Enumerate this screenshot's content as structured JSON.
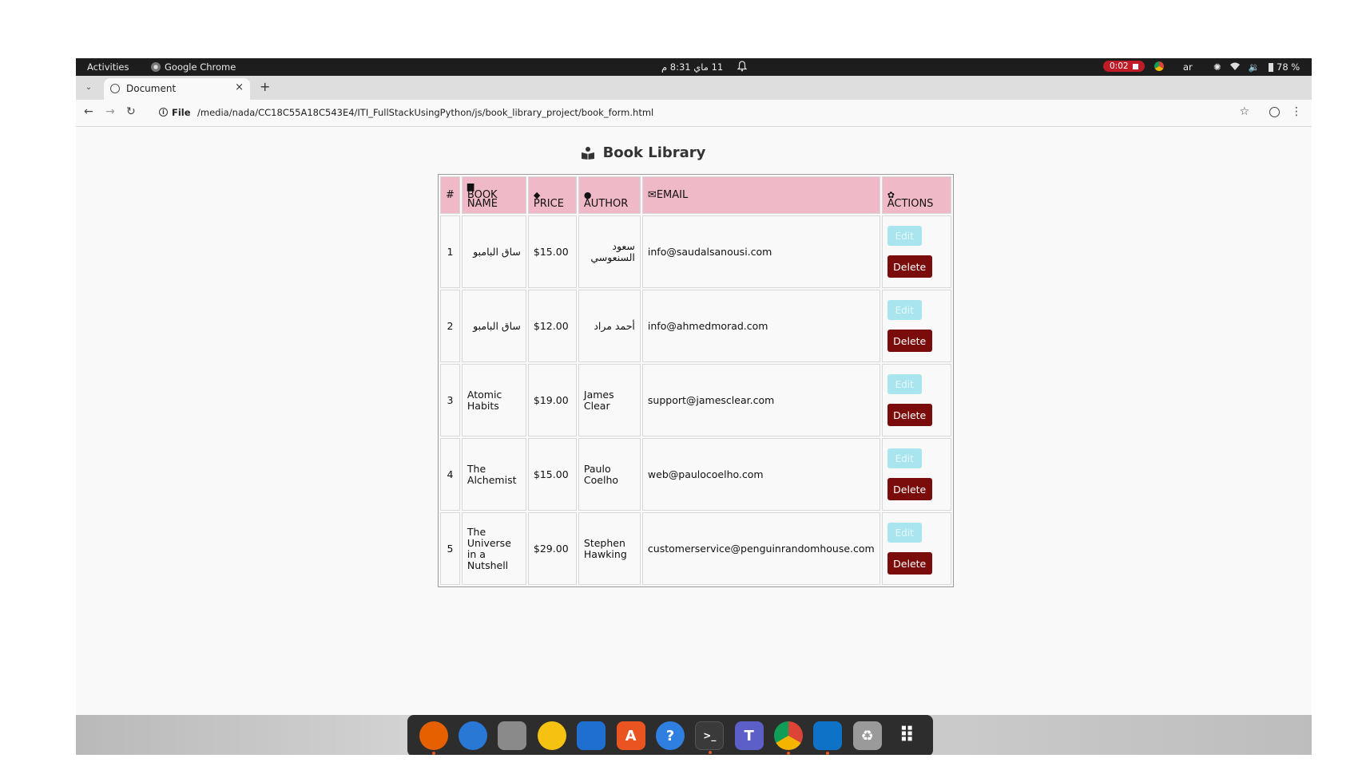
{
  "system_bar": {
    "activities": "Activities",
    "app_name": "Google Chrome",
    "clock": "11 ماي  8:31 م",
    "recording": "0:02",
    "language": "ar",
    "battery": "78 %"
  },
  "browser": {
    "tab_title": "Document",
    "new_tab": "+",
    "close": "×",
    "file_label": "File",
    "url": "/media/nada/CC18C55A18C543E4/ITI_FullStackUsingPython/js/book_library_project/book_form.html"
  },
  "page": {
    "title": "Book Library",
    "columns": {
      "num": "#",
      "book": "BOOK NAME",
      "price": "PRICE",
      "author": "AUTHOR",
      "email": "EMAIL",
      "actions": "ACTIONS"
    },
    "edit_label": "Edit",
    "delete_label": "Delete",
    "rows": [
      {
        "num": "1",
        "book": "ساق البامبو",
        "price": "$15.00",
        "author": "سعود السنعوسي",
        "email": "info@saudalsanousi.com"
      },
      {
        "num": "2",
        "book": "ساق البامبو",
        "price": "$12.00",
        "author": "أحمد مراد",
        "email": "info@ahmedmorad.com"
      },
      {
        "num": "3",
        "book": "Atomic Habits",
        "price": "$19.00",
        "author": "James Clear",
        "email": "support@jamesclear.com"
      },
      {
        "num": "4",
        "book": "The Alchemist",
        "price": "$15.00",
        "author": "Paulo Coelho",
        "email": "web@paulocoelho.com"
      },
      {
        "num": "5",
        "book": "The Universe in a Nutshell",
        "price": "$29.00",
        "author": "Stephen Hawking",
        "email": "customerservice@penguinrandomhouse.com"
      }
    ]
  },
  "dock": {
    "items": [
      {
        "name": "firefox-icon",
        "color": "#e66000",
        "glyph": ""
      },
      {
        "name": "thunderbird-icon",
        "color": "#2a78d6",
        "glyph": ""
      },
      {
        "name": "files-icon",
        "color": "#8a8a8a",
        "glyph": ""
      },
      {
        "name": "rhythmbox-icon",
        "color": "#f5c211",
        "glyph": ""
      },
      {
        "name": "writer-icon",
        "color": "#1f6fd1",
        "glyph": ""
      },
      {
        "name": "app-center-icon",
        "color": "#e95420",
        "glyph": "A"
      },
      {
        "name": "help-icon",
        "color": "#2f7fe0",
        "glyph": "?"
      },
      {
        "name": "terminal-icon",
        "color": "#3a3a3a",
        "glyph": ">_"
      },
      {
        "name": "teams-icon",
        "color": "#5b5fc7",
        "glyph": "T"
      },
      {
        "name": "chrome-icon",
        "color": "#db4437",
        "glyph": ""
      },
      {
        "name": "vscode-icon",
        "color": "#0e72c6",
        "glyph": ""
      },
      {
        "name": "trash-icon",
        "color": "#9a9a9a",
        "glyph": "♻"
      },
      {
        "name": "show-apps-icon",
        "color": "#2d2d2d",
        "glyph": "⠿"
      }
    ]
  }
}
